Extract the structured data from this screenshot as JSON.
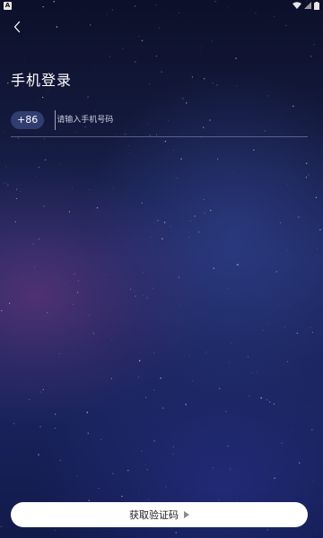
{
  "status_bar": {
    "app_badge": "A",
    "icons": [
      "wifi-icon",
      "signal-icon",
      "battery-icon"
    ]
  },
  "header": {
    "back_icon": "chevron-left-icon"
  },
  "login": {
    "title": "手机登录",
    "country_code": "+86",
    "phone_placeholder": "请输入手机号码",
    "phone_value": ""
  },
  "actions": {
    "get_code_label": "获取验证码",
    "get_code_icon": "play-arrow-icon"
  },
  "colors": {
    "background_top": "#0c1029",
    "background_mid": "#1f2a64",
    "accent_purple": "#5f3478",
    "button_bg": "#ffffff",
    "button_text": "#222222",
    "chip_bg": "#3c4882"
  }
}
